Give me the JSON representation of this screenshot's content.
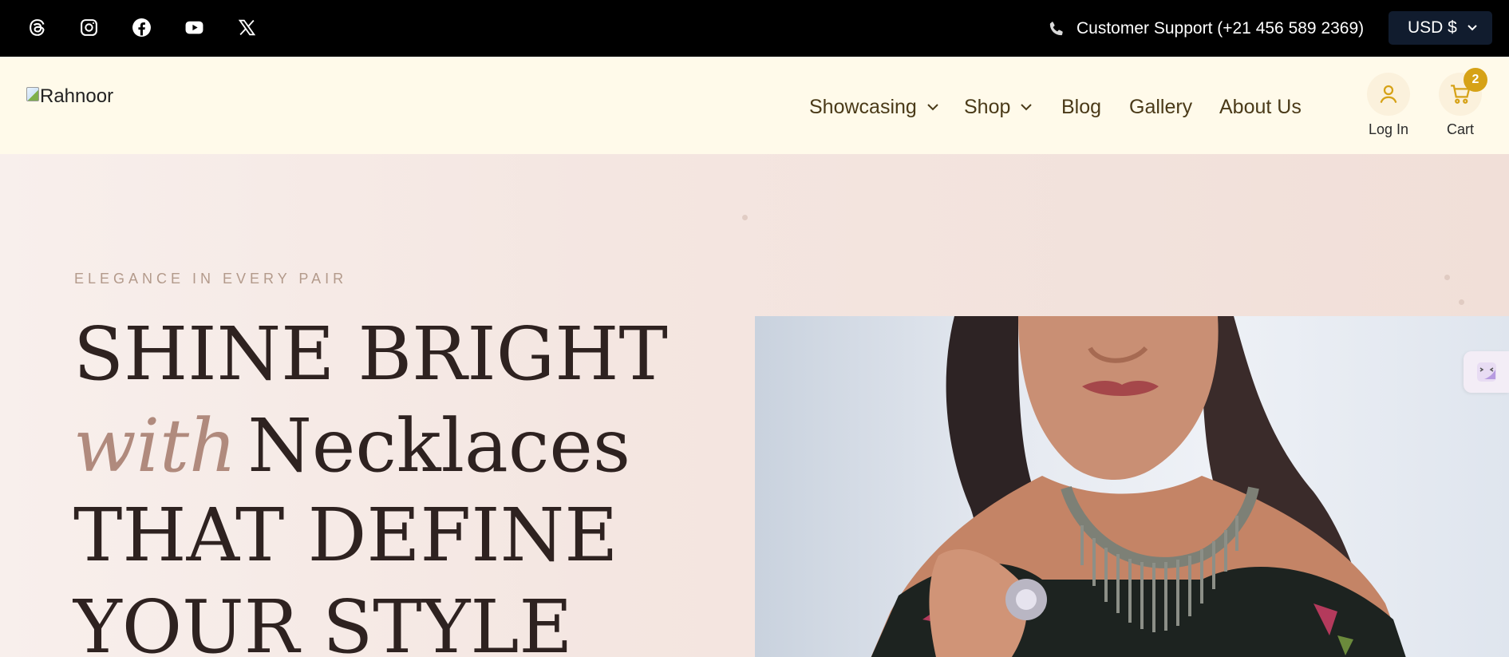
{
  "topbar": {
    "social_icons": [
      "threads-icon",
      "instagram-icon",
      "facebook-icon",
      "youtube-icon",
      "x-icon"
    ],
    "support_label": "Customer Support (+21 456 589 2369)",
    "currency_label": "USD $"
  },
  "header": {
    "logo_alt": "Rahnoor",
    "nav": [
      {
        "label": "Showcasing",
        "has_dropdown": true
      },
      {
        "label": "Shop",
        "has_dropdown": true
      },
      {
        "label": "Blog",
        "has_dropdown": false
      },
      {
        "label": "Gallery",
        "has_dropdown": false
      },
      {
        "label": "About Us",
        "has_dropdown": false
      }
    ],
    "login_label": "Log In",
    "cart_label": "Cart",
    "cart_count": "2"
  },
  "hero": {
    "eyebrow": "ELEGANCE IN EVERY PAIR",
    "line1": "SHINE BRIGHT",
    "line2_accent": "with",
    "line2_rest": "Necklaces",
    "line3": "THAT DEFINE",
    "line4": "YOUR STYLE"
  },
  "colors": {
    "topbar_bg": "#000000",
    "header_bg": "#fffaea",
    "nav_text": "#4a3a18",
    "badge": "#d6a217",
    "hero_bg": "#f4e6e1",
    "accent_text": "#b08a7d",
    "headline": "#2e2220"
  }
}
